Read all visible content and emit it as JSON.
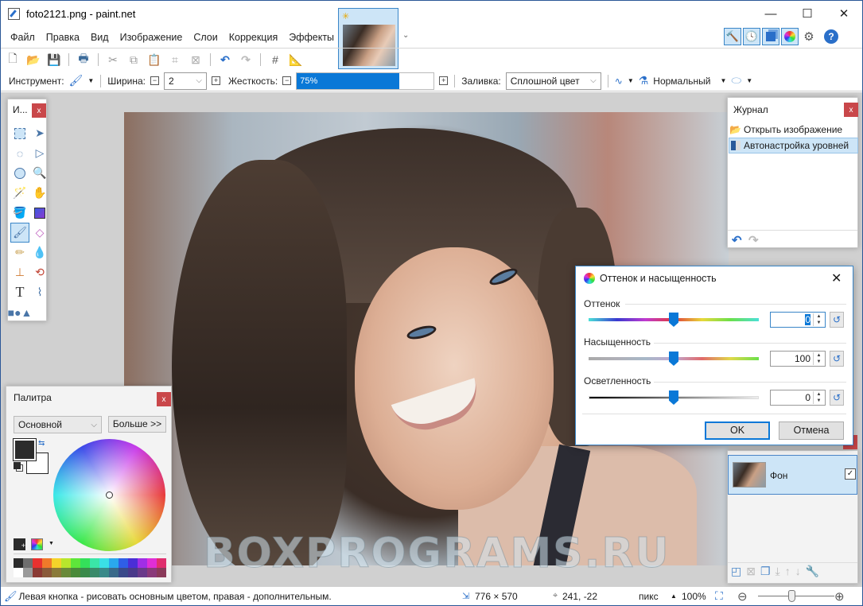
{
  "window": {
    "title": "foto2121.png - paint.net",
    "minimize": "—",
    "maximize": "☐",
    "close": "✕"
  },
  "menu": [
    "Файл",
    "Правка",
    "Вид",
    "Изображение",
    "Слои",
    "Коррекция",
    "Эффекты"
  ],
  "toolbar2": {
    "tool_label": "Инструмент:",
    "width_label": "Ширина:",
    "width_value": "2",
    "hardness_label": "Жесткость:",
    "hardness_value": "75%",
    "hardness_percent": 75,
    "fill_label": "Заливка:",
    "fill_value": "Сплошной цвет",
    "blend_value": "Нормальный"
  },
  "tools_panel": {
    "title": "И...",
    "close": "x"
  },
  "palette": {
    "title": "Палитра",
    "close": "x",
    "mode": "Основной",
    "more_button": "Больше >>",
    "primary_color": "#2b2b2b",
    "secondary_color": "#ffffff",
    "swatches_top": [
      "#2b2b2b",
      "#6e6e6e",
      "#e8312f",
      "#f07a2a",
      "#f4d32a",
      "#b8e62c",
      "#5ee63a",
      "#34e05a",
      "#3ae6a8",
      "#3ae0e6",
      "#2aa8ee",
      "#2f5ee6",
      "#4a2ed6",
      "#a02ee6",
      "#e02ed6",
      "#e02e6e"
    ],
    "swatches_bottom": [
      "#ffffff",
      "#9a9a9a",
      "#8a3a34",
      "#8a5a3a",
      "#8a7a3a",
      "#6a8a3a",
      "#4a8a3a",
      "#3a8a4a",
      "#3a8a6a",
      "#3a8a8a",
      "#3a6a8a",
      "#3a4a8a",
      "#4a3a8a",
      "#6a3a8a",
      "#8a3a7a",
      "#8a3a5a"
    ]
  },
  "history": {
    "title": "Журнал",
    "close": "x",
    "items": [
      {
        "label": "Открыть изображение",
        "selected": false
      },
      {
        "label": "Автонастройка уровней",
        "selected": true
      }
    ]
  },
  "layers": {
    "items": [
      {
        "label": "Фон",
        "visible": true
      }
    ]
  },
  "dialog": {
    "title": "Оттенок и насыщенность",
    "close": "✕",
    "hue_label": "Оттенок",
    "hue_value": "0",
    "saturation_label": "Насыщенность",
    "saturation_value": "100",
    "lightness_label": "Осветленность",
    "lightness_value": "0",
    "ok": "OK",
    "cancel": "Отмена"
  },
  "canvas": {
    "watermark": "BOXPROGRAMS.RU"
  },
  "status": {
    "hint": "Левая кнопка - рисовать основным цветом, правая - дополнительным.",
    "image_size": "776 × 570",
    "cursor_pos": "241, -22",
    "units": "пикс",
    "zoom": "100%"
  }
}
